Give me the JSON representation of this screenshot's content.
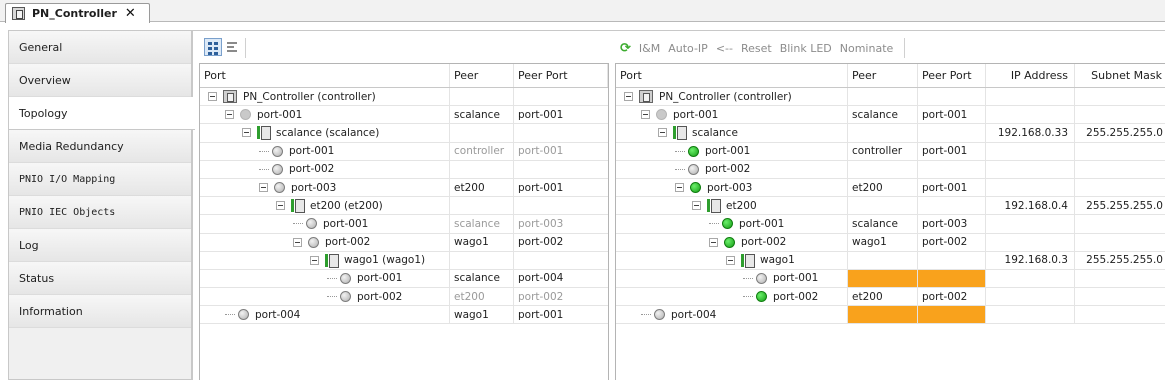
{
  "document_tab": {
    "title": "PN_Controller",
    "close": "✕"
  },
  "nav": {
    "items": [
      {
        "label": "General"
      },
      {
        "label": "Overview"
      },
      {
        "label": "Topology",
        "active": true
      },
      {
        "label": "Media Redundancy"
      },
      {
        "label": "PNIO I/O Mapping"
      },
      {
        "label": "PNIO IEC Objects"
      },
      {
        "label": "Log"
      },
      {
        "label": "Status"
      },
      {
        "label": "Information"
      }
    ]
  },
  "left_toolbar": {
    "tree_view_icon": "tree-view-icon",
    "list_view_icon": "list-view-icon"
  },
  "right_toolbar": {
    "refresh_icon": "refresh-icon",
    "refresh_glyph": "⟳",
    "items": [
      "I&M",
      "Auto-IP",
      "<--",
      "Reset",
      "Blink LED",
      "Nominate"
    ]
  },
  "left_grid": {
    "columns": [
      "Port",
      "Peer",
      "Peer Port"
    ],
    "rows": [
      {
        "depth": 0,
        "icon": "controller",
        "expander": true,
        "name": "PN_Controller (controller)",
        "peer": "",
        "peer_port": ""
      },
      {
        "depth": 1,
        "icon": "port-light",
        "expander": true,
        "name": "port-001",
        "peer": "scalance",
        "peer_port": "port-001"
      },
      {
        "depth": 2,
        "icon": "device",
        "expander": true,
        "name": "scalance (scalance)",
        "peer": "",
        "peer_port": ""
      },
      {
        "depth": 3,
        "icon": "port",
        "expander": false,
        "name": "port-001",
        "peer": "controller",
        "peer_port": "port-001",
        "gray": true
      },
      {
        "depth": 3,
        "icon": "port",
        "expander": false,
        "name": "port-002",
        "peer": "",
        "peer_port": ""
      },
      {
        "depth": 3,
        "icon": "port",
        "expander": true,
        "name": "port-003",
        "peer": "et200",
        "peer_port": "port-001"
      },
      {
        "depth": 4,
        "icon": "device",
        "expander": true,
        "name": "et200 (et200)",
        "peer": "",
        "peer_port": ""
      },
      {
        "depth": 5,
        "icon": "port",
        "expander": false,
        "name": "port-001",
        "peer": "scalance",
        "peer_port": "port-003",
        "gray": true
      },
      {
        "depth": 5,
        "icon": "port",
        "expander": true,
        "name": "port-002",
        "peer": "wago1",
        "peer_port": "port-002"
      },
      {
        "depth": 6,
        "icon": "device",
        "expander": true,
        "name": "wago1 (wago1)",
        "peer": "",
        "peer_port": ""
      },
      {
        "depth": 7,
        "icon": "port",
        "expander": false,
        "name": "port-001",
        "peer": "scalance",
        "peer_port": "port-004"
      },
      {
        "depth": 7,
        "icon": "port",
        "expander": false,
        "name": "port-002",
        "peer": "et200",
        "peer_port": "port-002",
        "gray": true
      },
      {
        "depth": 1,
        "icon": "port",
        "expander": false,
        "name": "port-004",
        "peer": "wago1",
        "peer_port": "port-001"
      }
    ]
  },
  "right_grid": {
    "columns": [
      "Port",
      "Peer",
      "Peer Port",
      "IP Address",
      "Subnet Mask"
    ],
    "rows": [
      {
        "depth": 0,
        "icon": "controller",
        "expander": true,
        "name": "PN_Controller (controller)",
        "peer": "",
        "peer_port": "",
        "ip": "",
        "mask": ""
      },
      {
        "depth": 1,
        "icon": "port-light",
        "expander": true,
        "name": "port-001",
        "peer": "scalance",
        "peer_port": "port-001",
        "ip": "",
        "mask": ""
      },
      {
        "depth": 2,
        "icon": "device",
        "expander": true,
        "name": "scalance",
        "peer": "",
        "peer_port": "",
        "ip": "192.168.0.33",
        "mask": "255.255.255.0"
      },
      {
        "depth": 3,
        "icon": "port-green",
        "expander": false,
        "name": "port-001",
        "peer": "controller",
        "peer_port": "port-001",
        "ip": "",
        "mask": ""
      },
      {
        "depth": 3,
        "icon": "port",
        "expander": false,
        "name": "port-002",
        "peer": "",
        "peer_port": "",
        "ip": "",
        "mask": ""
      },
      {
        "depth": 3,
        "icon": "port-green",
        "expander": true,
        "name": "port-003",
        "peer": "et200",
        "peer_port": "port-001",
        "ip": "",
        "mask": ""
      },
      {
        "depth": 4,
        "icon": "device",
        "expander": true,
        "name": "et200",
        "peer": "",
        "peer_port": "",
        "ip": "192.168.0.4",
        "mask": "255.255.255.0"
      },
      {
        "depth": 5,
        "icon": "port-green",
        "expander": false,
        "name": "port-001",
        "peer": "scalance",
        "peer_port": "port-003",
        "ip": "",
        "mask": ""
      },
      {
        "depth": 5,
        "icon": "port-green",
        "expander": true,
        "name": "port-002",
        "peer": "wago1",
        "peer_port": "port-002",
        "ip": "",
        "mask": ""
      },
      {
        "depth": 6,
        "icon": "device",
        "expander": true,
        "name": "wago1",
        "peer": "",
        "peer_port": "",
        "ip": "192.168.0.3",
        "mask": "255.255.255.0"
      },
      {
        "depth": 7,
        "icon": "port",
        "expander": false,
        "name": "port-001",
        "peer": "",
        "peer_port": "",
        "ip": "",
        "mask": "",
        "mismatch": true
      },
      {
        "depth": 7,
        "icon": "port-green",
        "expander": false,
        "name": "port-002",
        "peer": "et200",
        "peer_port": "port-002",
        "ip": "",
        "mask": ""
      },
      {
        "depth": 1,
        "icon": "port",
        "expander": false,
        "name": "port-004",
        "peer": "",
        "peer_port": "",
        "ip": "",
        "mask": "",
        "mismatch": true
      }
    ]
  },
  "colors": {
    "mismatch": "#f9a21c",
    "port_ok": "#1db51d",
    "device_bar": "#2e9e2e",
    "toolbar_disabled": "#8c8c8c"
  }
}
